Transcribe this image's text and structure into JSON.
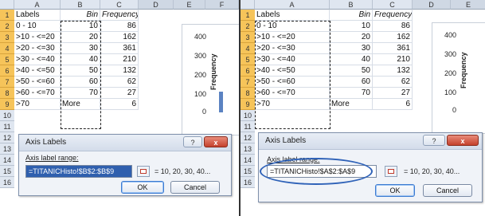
{
  "columns_left": [
    "A",
    "B",
    "C",
    "D",
    "E",
    "F"
  ],
  "columns_right": [
    "A",
    "B",
    "C",
    "D",
    "E"
  ],
  "row_numbers": [
    "1",
    "2",
    "3",
    "4",
    "5",
    "6",
    "7",
    "8",
    "9",
    "10",
    "11",
    "12",
    "13",
    "14",
    "15",
    "16"
  ],
  "headers": {
    "a": "Labels",
    "b": "Bin",
    "c": "Frequency"
  },
  "rows_left": [
    {
      "a": "0 - 10",
      "b": "10",
      "c": "86"
    },
    {
      "a": ">10 - <=20",
      "b": "20",
      "c": "162"
    },
    {
      "a": ">20 - <=30",
      "b": "30",
      "c": "361"
    },
    {
      "a": ">30 - <=40",
      "b": "40",
      "c": "210"
    },
    {
      "a": ">40 - <=50",
      "b": "50",
      "c": "132"
    },
    {
      "a": ">50 - <=60",
      "b": "60",
      "c": "62"
    },
    {
      "a": ">60 - <=70",
      "b": "70",
      "c": "27"
    },
    {
      "a": ">70",
      "b": "More",
      "c": "6"
    }
  ],
  "rows_right": [
    {
      "a": "0 - 10",
      "b": "10",
      "c": "86"
    },
    {
      "a": ">10 - <=20",
      "b": "20",
      "c": "162"
    },
    {
      "a": ">20 - <=30",
      "b": "30",
      "c": "361"
    },
    {
      "a": ">30 - <=40",
      "b": "40",
      "c": "210"
    },
    {
      "a": ">40 - <=50",
      "b": "50",
      "c": "132"
    },
    {
      "a": ">50 - <=60",
      "b": "60",
      "c": "62"
    },
    {
      "a": ">60 - <=70",
      "b": "70",
      "c": "27"
    },
    {
      "a": ">70",
      "b": "More",
      "c": "6"
    }
  ],
  "chart": {
    "ylabel": "Frequency",
    "ticks": [
      "400",
      "300",
      "200",
      "100",
      "0"
    ]
  },
  "dialog_left": {
    "title": "Axis Labels",
    "help_label": "?",
    "close_label": "x",
    "field_label": "Axis label range:",
    "value": "=TITANICHisto!$B$2:$B$9",
    "preview": "= 10, 20, 30, 40...",
    "ok": "OK",
    "cancel": "Cancel"
  },
  "dialog_right": {
    "title": "Axis Labels",
    "help_label": "?",
    "close_label": "x",
    "field_label": "Axis label range:",
    "value": "=TITANICHisto!$A$2:$A$9",
    "preview": "= 10, 20, 30, 40...",
    "ok": "OK",
    "cancel": "Cancel"
  },
  "colors": {
    "row_header_active": "#f6c45a",
    "selection": "#2f5fae",
    "highlight_circle": "#2f62b8"
  }
}
